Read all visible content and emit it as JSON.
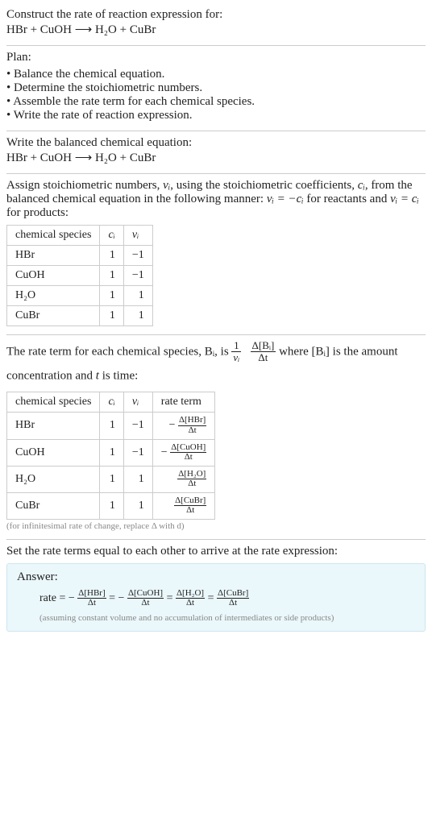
{
  "intro": {
    "prompt": "Construct the rate of reaction expression for:",
    "equation": "HBr + CuOH ⟶ H₂O + CuBr"
  },
  "plan": {
    "heading": "Plan:",
    "items": [
      "Balance the chemical equation.",
      "Determine the stoichiometric numbers.",
      "Assemble the rate term for each chemical species.",
      "Write the rate of reaction expression."
    ]
  },
  "balanced": {
    "heading": "Write the balanced chemical equation:",
    "equation": "HBr + CuOH ⟶ H₂O + CuBr"
  },
  "assign": {
    "text_before": "Assign stoichiometric numbers, ",
    "nu": "νᵢ",
    "text_mid1": ", using the stoichiometric coefficients, ",
    "ci": "cᵢ",
    "text_mid2": ", from the balanced chemical equation in the following manner: ",
    "rel_reactants": "νᵢ = −cᵢ",
    "text_mid3": " for reactants and ",
    "rel_products": "νᵢ = cᵢ",
    "text_after": " for products:",
    "headers": {
      "species": "chemical species",
      "ci": "cᵢ",
      "nu": "νᵢ"
    },
    "rows": [
      {
        "species": "HBr",
        "ci": "1",
        "nu": "−1"
      },
      {
        "species": "CuOH",
        "ci": "1",
        "nu": "−1"
      },
      {
        "species": "H₂O",
        "ci": "1",
        "nu": "1"
      },
      {
        "species": "CuBr",
        "ci": "1",
        "nu": "1"
      }
    ]
  },
  "rateterm": {
    "text_before": "The rate term for each chemical species, Bᵢ, is ",
    "frac1_top": "1",
    "frac1_bot": "νᵢ",
    "frac2_top": "Δ[Bᵢ]",
    "frac2_bot": "Δt",
    "text_mid": " where [Bᵢ] is the amount concentration and ",
    "t": "t",
    "text_after": " is time:",
    "headers": {
      "species": "chemical species",
      "ci": "cᵢ",
      "nu": "νᵢ",
      "rate": "rate term"
    },
    "rows": [
      {
        "species": "HBr",
        "ci": "1",
        "nu": "−1",
        "sign": "− ",
        "top": "Δ[HBr]",
        "bot": "Δt"
      },
      {
        "species": "CuOH",
        "ci": "1",
        "nu": "−1",
        "sign": "− ",
        "top": "Δ[CuOH]",
        "bot": "Δt"
      },
      {
        "species": "H₂O",
        "ci": "1",
        "nu": "1",
        "sign": "",
        "top": "Δ[H₂O]",
        "bot": "Δt"
      },
      {
        "species": "CuBr",
        "ci": "1",
        "nu": "1",
        "sign": "",
        "top": "Δ[CuBr]",
        "bot": "Δt"
      }
    ],
    "note": "(for infinitesimal rate of change, replace Δ with d)"
  },
  "final": {
    "heading": "Set the rate terms equal to each other to arrive at the rate expression:"
  },
  "answer": {
    "label": "Answer:",
    "lhs": "rate = ",
    "terms": [
      {
        "sign": "− ",
        "top": "Δ[HBr]",
        "bot": "Δt"
      },
      {
        "sign": "− ",
        "top": "Δ[CuOH]",
        "bot": "Δt"
      },
      {
        "sign": "",
        "top": "Δ[H₂O]",
        "bot": "Δt"
      },
      {
        "sign": "",
        "top": "Δ[CuBr]",
        "bot": "Δt"
      }
    ],
    "eq_sep": " = ",
    "note": "(assuming constant volume and no accumulation of intermediates or side products)"
  }
}
